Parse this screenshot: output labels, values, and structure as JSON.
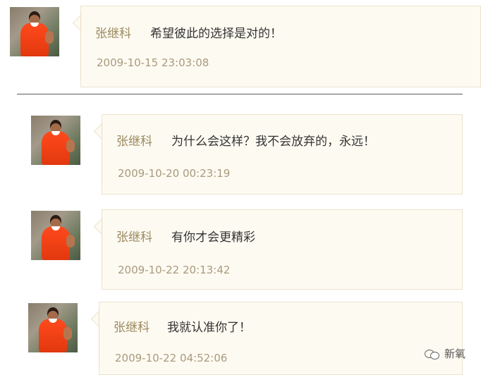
{
  "comments": [
    {
      "author": "张继科",
      "message": "希望彼此的选择是对的！",
      "timestamp": "2009-10-15 23:03:08"
    },
    {
      "author": "张继科",
      "message": "为什么会这样？我不会放弃的，永远！",
      "timestamp": "2009-10-20 00:23:19"
    },
    {
      "author": "张继科",
      "message": "有你才会更精彩",
      "timestamp": "2009-10-22 20:13:42"
    },
    {
      "author": "张继科",
      "message": "我就认准你了！",
      "timestamp": "2009-10-22 04:52:06"
    }
  ],
  "watermark": {
    "text": "新氧",
    "icon": "wechat-icon"
  }
}
